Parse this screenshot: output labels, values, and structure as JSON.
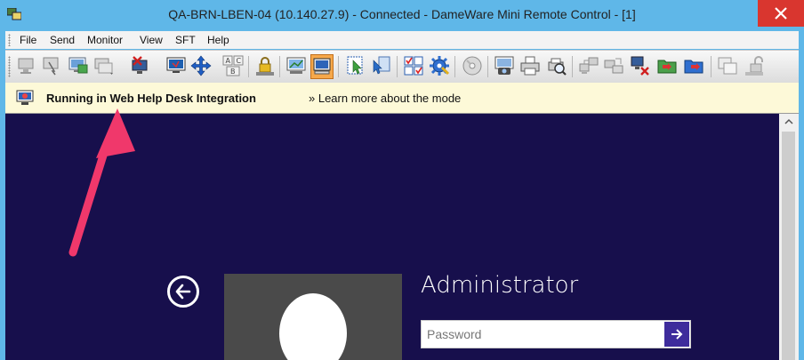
{
  "window": {
    "title": "QA-BRN-LBEN-04 (10.140.27.9) - Connected - DameWare Mini Remote Control - [1]"
  },
  "menu": [
    "File",
    "Send",
    "Monitor",
    "View",
    "SFT",
    "Help"
  ],
  "toolbar": {
    "buttons": [
      "view-only-icon",
      "send-ctrl-alt-del-icon",
      "screen-refresh-icon",
      "monitor-select-icon",
      "disconnect-icon",
      "remote-desktop-icon",
      "move-icon",
      "keyboard-layout-icon",
      "lock-keyboard-icon",
      "smart-card-icon",
      "chat-icon",
      "select-region-icon",
      "pointer-icon",
      "checklist-icon",
      "settings-icon",
      "disc-icon",
      "screenshot-icon",
      "printer-icon",
      "print-preview-icon",
      "network-icon",
      "share-icon",
      "remove-host-icon",
      "file-transfer-icon",
      "folder-sync-icon",
      "window-icon",
      "unlock-icon"
    ]
  },
  "infobar": {
    "title": "Running in Web Help Desk Integration",
    "link": "» Learn more about the mode"
  },
  "login": {
    "username": "Administrator",
    "password_placeholder": "Password"
  },
  "colors": {
    "titlebar": "#5fb7e8",
    "remote_background": "#170f4c",
    "close_button": "#d9362f",
    "submit_button": "#3e2c9c",
    "annotation_arrow": "#f0386b"
  }
}
